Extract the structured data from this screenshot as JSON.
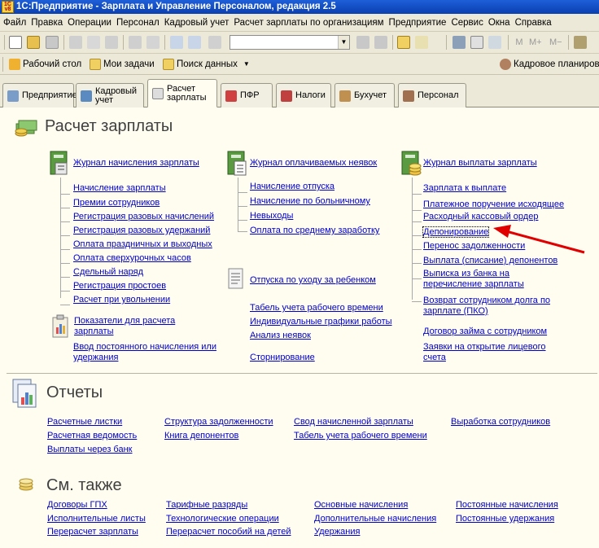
{
  "window": {
    "title": "1С:Предприятие - Зарплата и Управление Персоналом, редакция 2.5",
    "app_icon_text": "1С v8"
  },
  "menu": [
    "Файл",
    "Правка",
    "Операции",
    "Персонал",
    "Кадровый учет",
    "Расчет зарплаты по организациям",
    "Предприятие",
    "Сервис",
    "Окна",
    "Справка"
  ],
  "navbar": {
    "desktop": "Рабочий стол",
    "tasks": "Мои задачи",
    "search": "Поиск данных",
    "planning": "Кадровое планирова"
  },
  "tabs": [
    {
      "label": "Предприятие"
    },
    {
      "label": "Кадровый учет"
    },
    {
      "label": "Расчет зарплаты"
    },
    {
      "label": "ПФР"
    },
    {
      "label": "Налоги"
    },
    {
      "label": "Бухучет"
    },
    {
      "label": "Персонал"
    }
  ],
  "main": {
    "title": "Расчет зарплаты",
    "col1": {
      "journal": "Журнал начисления зарплаты",
      "items": [
        "Начисление зарплаты",
        "Премии сотрудников",
        "Регистрация разовых начислений",
        "Регистрация разовых удержаний",
        "Оплата праздничных и выходных",
        "Оплата сверхурочных часов",
        "Сдельный наряд",
        "Регистрация простоев",
        "Расчет при увольнении"
      ],
      "indicators_line1": "Показатели для расчета",
      "indicators_line2": "зарплаты",
      "permanent_line1": "Ввод постоянного начисления или",
      "permanent_line2": "удержания"
    },
    "col2": {
      "journal": "Журнал оплачиваемых неявок",
      "items": [
        "Начисление отпуска",
        "Начисление по больничному",
        "Невыходы",
        "Оплата по среднему заработку"
      ],
      "childcare": "Отпуска по уходу за ребенком",
      "timesheet": "Табель учета рабочего времени",
      "schedules": "Индивидуальные графики работы",
      "absence": "Анализ неявок",
      "storno": "Сторнирование"
    },
    "col3": {
      "journal": "Журнал выплаты зарплаты",
      "items": [
        "Зарплата к выплате",
        "Платежное поручение исходящее",
        "Расходный кассовый ордер",
        "Депонирование",
        "Перенос задолженности",
        "Выплата (списание) депонентов"
      ],
      "bank_line1": "Выписка из банка на",
      "bank_line2": "перечисление зарплаты",
      "return_line1": "Возврат сотрудником долга по",
      "return_line2": "зарплате (ПКО)",
      "loan": "Договор займа с сотрудником",
      "card_line1": "Заявки на открытие лицевого",
      "card_line2": "счета"
    }
  },
  "reports": {
    "title": "Отчеты",
    "links": [
      "Расчетные листки",
      "Расчетная ведомость",
      "Выплаты через банк",
      "Структура задолженности",
      "Книга депонентов",
      "Свод начисленной зарплаты",
      "Табель учета рабочего времени",
      "Выработка сотрудников"
    ]
  },
  "see_also": {
    "title": "См. также",
    "links": [
      "Договоры ГПХ",
      "Исполнительные листы",
      "Перерасчет зарплаты",
      "Тарифные разряды",
      "Технологические операции",
      "Перерасчет пособий на детей",
      "Основные начисления",
      "Дополнительные начисления",
      "Удержания",
      "Постоянные начисления",
      "Постоянные удержания"
    ]
  },
  "colors": {
    "link": "#0000cc",
    "title_bar": "#0a3fb0",
    "background": "#fffcf0",
    "arrow": "#e00000"
  }
}
